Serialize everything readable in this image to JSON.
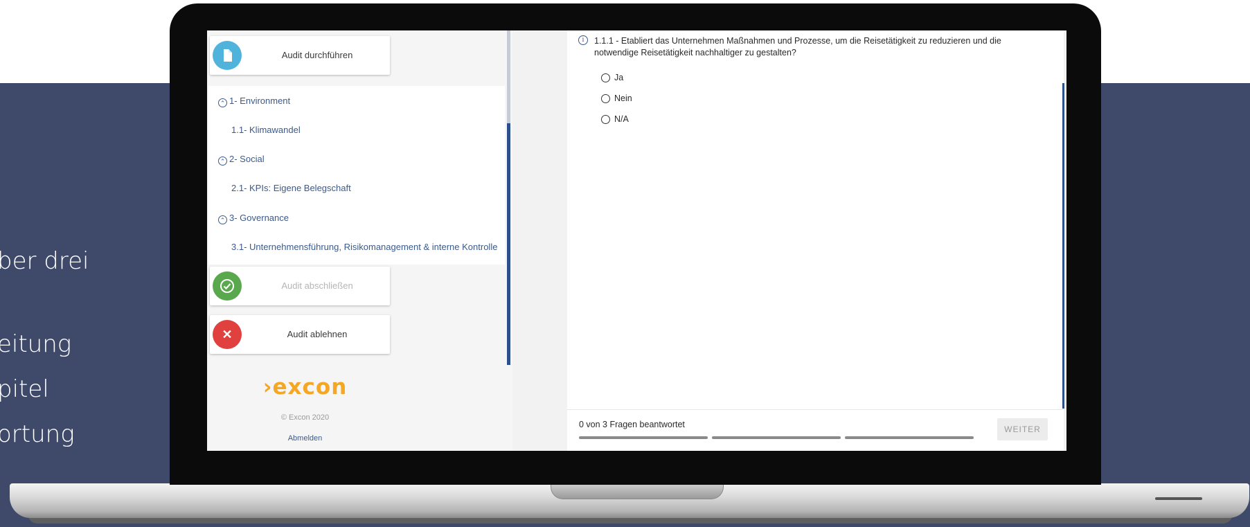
{
  "slide": {
    "lines": [
      "ber drei",
      "eitung",
      "pitel",
      "ortung"
    ]
  },
  "sidebar": {
    "actions": {
      "perform": {
        "label": "Audit durchführen",
        "icon": "document-icon",
        "color": "#4fb3dc"
      },
      "complete": {
        "label": "Audit abschließen",
        "icon": "check-icon",
        "color": "#5aa84e"
      },
      "reject": {
        "label": "Audit ablehnen",
        "icon": "close-icon",
        "color": "#e0403e"
      }
    },
    "nav": [
      {
        "label": "1- Environment",
        "type": "chapter"
      },
      {
        "label": "1.1- Klimawandel",
        "type": "section"
      },
      {
        "label": "2- Social",
        "type": "chapter"
      },
      {
        "label": "2.1- KPIs: Eigene Belegschaft",
        "type": "section"
      },
      {
        "label": "3- Governance",
        "type": "chapter"
      },
      {
        "label": "3.1- Unternehmensführung, Risikomanagement & interne Kontrolle",
        "type": "section"
      }
    ],
    "logo": "›excon",
    "copyright": "© Excon 2020",
    "logout": "Abmelden"
  },
  "question": {
    "text": "1.1.1 - Etabliert das Unternehmen Maßnahmen und Prozesse, um die Reisetätigkeit zu reduzieren und die notwendige Reisetätigkeit nachhaltiger zu gestalten?",
    "options": [
      "Ja",
      "Nein",
      "N/A"
    ]
  },
  "footer": {
    "progress": "0 von 3 Fragen beantwortet",
    "answered": 0,
    "total": 3,
    "next_label": "WEITER"
  },
  "colors": {
    "band": "#3f4a6b",
    "accent": "#3b5a8c",
    "logo": "#f5a623"
  }
}
